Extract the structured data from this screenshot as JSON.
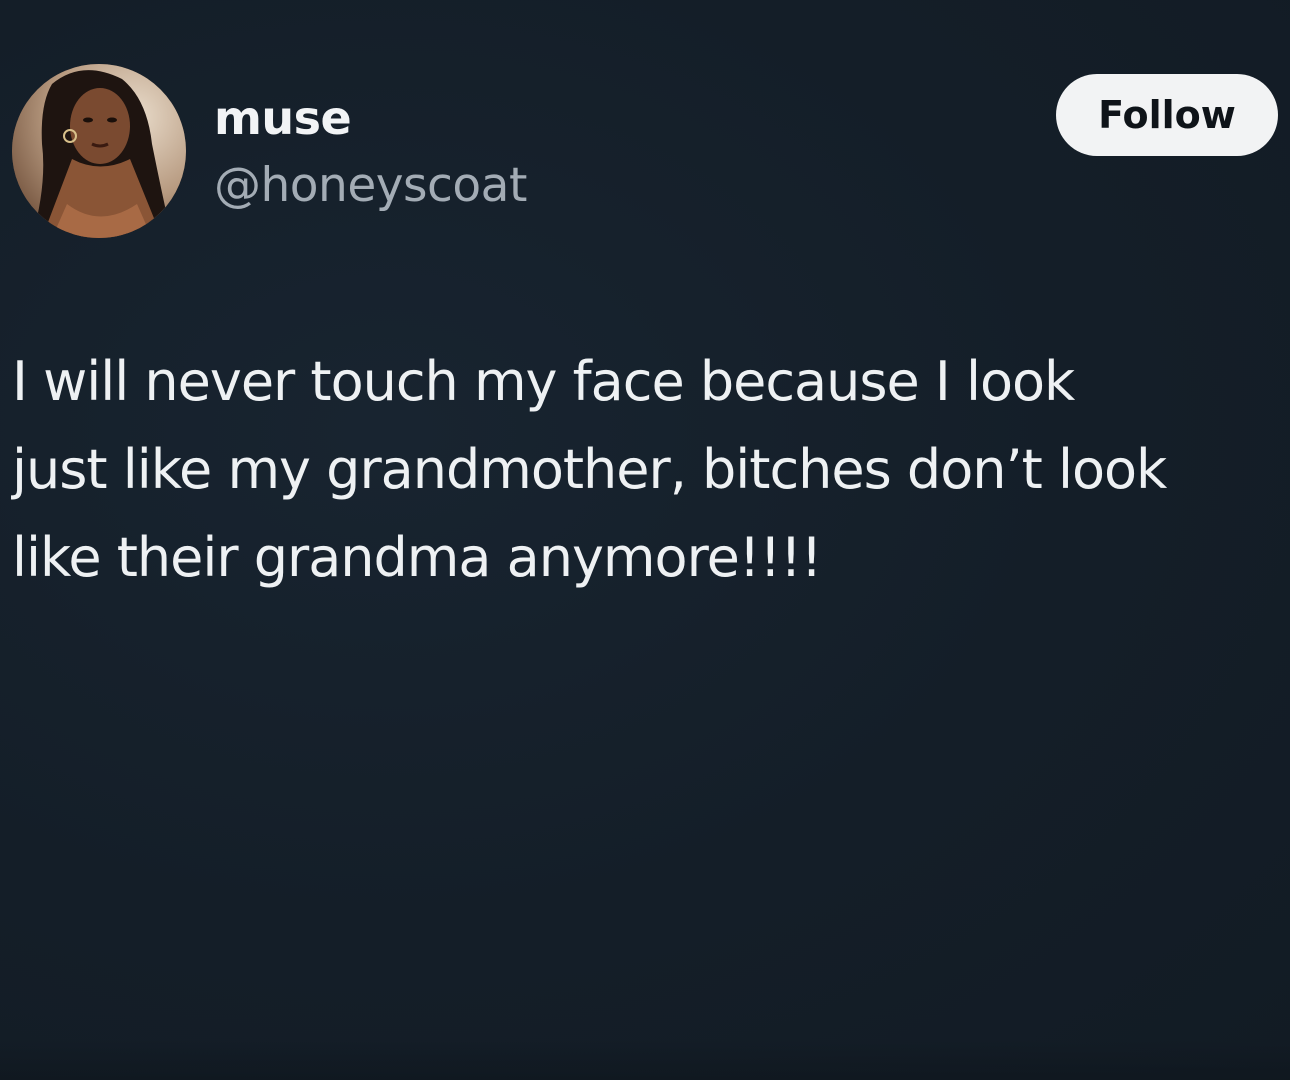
{
  "user": {
    "display_name": "muse",
    "handle": "@honeyscoat"
  },
  "follow_button": {
    "label": "Follow"
  },
  "tweet": {
    "lines": [
      "I will never touch my face because I look",
      "just like my grandmother, bitches don’t look",
      "like their grandma anymore!!!!"
    ]
  },
  "colors": {
    "background": "#141d26",
    "text_primary": "#eef1f3",
    "text_secondary": "#a3acb5",
    "button_bg": "#f2f3f4",
    "button_text": "#0f1419"
  }
}
